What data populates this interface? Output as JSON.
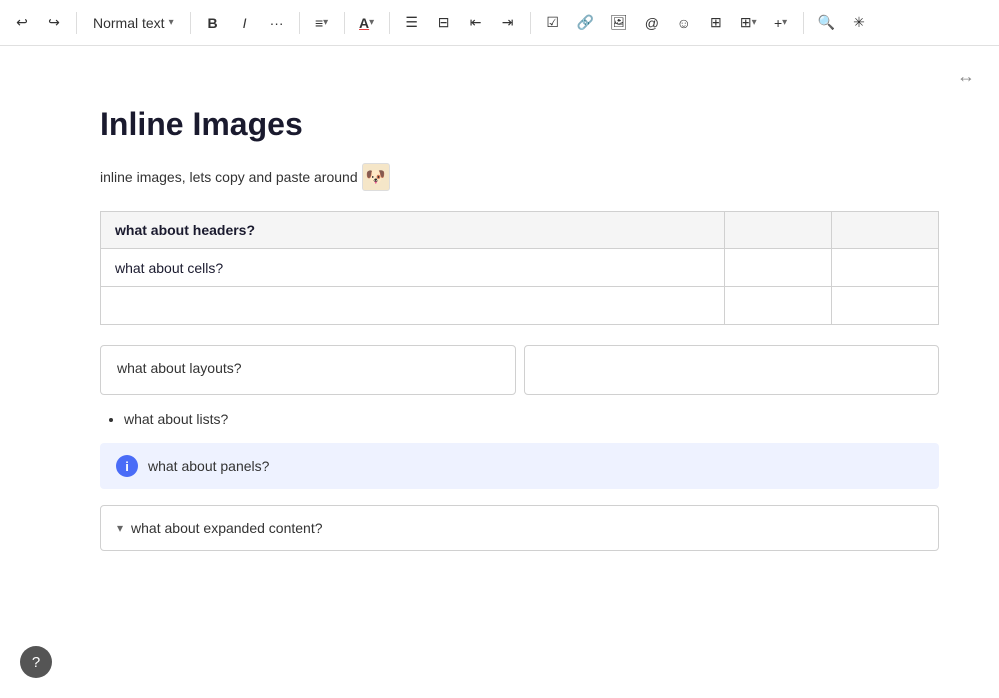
{
  "toolbar": {
    "undo_label": "↩",
    "redo_label": "↪",
    "text_style_label": "Normal text",
    "bold_label": "B",
    "italic_label": "I",
    "more_label": "···",
    "align_label": "≡",
    "color_label": "A",
    "bullet_label": "≡",
    "numbered_label": "⁚",
    "outdent_label": "⇤",
    "indent_label": "⇥",
    "check_label": "☑",
    "link_label": "🔗",
    "image_label": "🖼",
    "mention_label": "@",
    "emoji_label": "☺",
    "columns_label": "⊟",
    "table_label": "⊞",
    "add_label": "+",
    "search_label": "🔍",
    "ai_label": "✳"
  },
  "editor": {
    "page_title": "Inline Images",
    "intro_text": "inline images, lets copy and paste around",
    "expand_icon": "↔",
    "table": {
      "headers": [
        "what about headers?",
        "",
        ""
      ],
      "rows": [
        [
          "what about cells?",
          "",
          ""
        ],
        [
          "",
          "",
          ""
        ]
      ]
    },
    "layout": {
      "block1": "what about layouts?",
      "block2": ""
    },
    "list": {
      "items": [
        "what about lists?"
      ]
    },
    "panel": {
      "text": "what about panels?"
    },
    "expandable": {
      "text": "what about expanded content?"
    }
  },
  "help": {
    "label": "?"
  }
}
